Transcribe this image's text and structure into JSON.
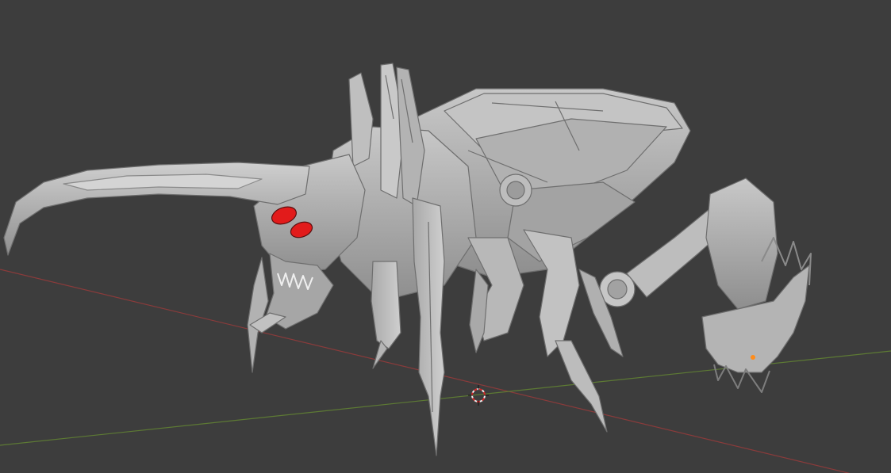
{
  "viewport": {
    "background": "#3d3d3d",
    "x_axis_color": "#8a3b3b",
    "y_axis_color": "#5d7a34"
  },
  "model": {
    "base_color": "#b9b9b9",
    "shadow_color": "#8c8c8c",
    "edge_color": "#6f6f6f",
    "eye_color": "#e21b1b",
    "icon": "insect-mech-model"
  },
  "cursor_3d": {
    "icon": "3d-cursor-icon",
    "ring_color_a": "#d02a2a",
    "ring_color_b": "#f0f0f0"
  },
  "object_origin": {
    "icon": "origin-dot-icon",
    "color": "#ff8c1a"
  }
}
